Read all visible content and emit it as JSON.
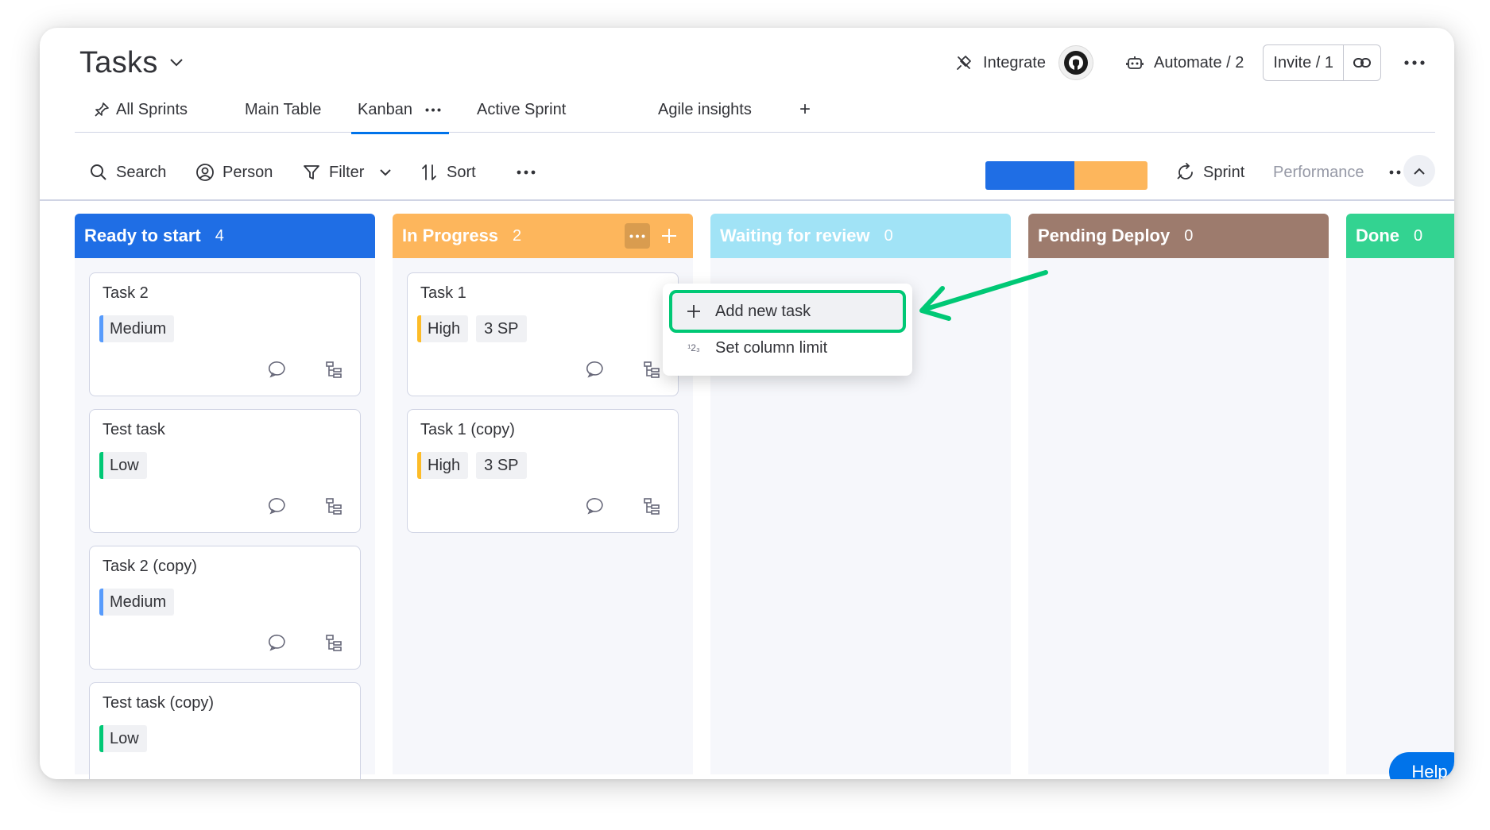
{
  "header": {
    "title": "Tasks",
    "integrate_label": "Integrate",
    "automate_label": "Automate / 2",
    "invite_label": "Invite / 1"
  },
  "tabs": [
    {
      "label": "All Sprints",
      "icon": "pin-icon"
    },
    {
      "label": "Main Table"
    },
    {
      "label": "Kanban",
      "active": true
    },
    {
      "label": "Active Sprint"
    },
    {
      "label": "Agile insights"
    },
    {
      "label": "+"
    }
  ],
  "toolbar": {
    "search_label": "Search",
    "person_label": "Person",
    "filter_label": "Filter",
    "sort_label": "Sort",
    "sprint_label": "Sprint",
    "performance_label": "Performance",
    "progress": [
      {
        "fraction": 0.55,
        "color": "#1f6ee5"
      },
      {
        "fraction": 0.45,
        "color": "#fdb65c"
      }
    ]
  },
  "columns": [
    {
      "title": "Ready to start",
      "count": "4",
      "color": "#1f6ee5",
      "cards": [
        {
          "title": "Task 2",
          "tags": [
            {
              "text": "Medium",
              "color": "#579bfc"
            }
          ]
        },
        {
          "title": "Test task",
          "tags": [
            {
              "text": "Low",
              "color": "#00c875"
            }
          ]
        },
        {
          "title": "Task 2 (copy)",
          "tags": [
            {
              "text": "Medium",
              "color": "#579bfc"
            }
          ]
        },
        {
          "title": "Test task (copy)",
          "tags": [
            {
              "text": "Low",
              "color": "#00c875"
            }
          ]
        }
      ]
    },
    {
      "title": "In Progress",
      "count": "2",
      "color": "#fdb65c",
      "cards": [
        {
          "title": "Task 1",
          "tags": [
            {
              "text": "High",
              "color": "#fdbc28"
            }
          ],
          "sp": "3  SP"
        },
        {
          "title": "Task 1 (copy)",
          "tags": [
            {
              "text": "High",
              "color": "#fdbc28"
            }
          ],
          "sp": "3  SP"
        }
      ]
    },
    {
      "title": "Waiting for review",
      "count": "0",
      "color": "#a1e3f6",
      "cards": []
    },
    {
      "title": "Pending Deploy",
      "count": "0",
      "color": "#9d7b6d",
      "cards": []
    },
    {
      "title": "Done",
      "count": "0",
      "color": "#33d391",
      "cards": []
    }
  ],
  "menu": {
    "add_new_task": "Add new task",
    "set_column_limit": "Set column limit",
    "limit_icon_glyph": "¹2₃"
  },
  "help_label": "Help"
}
